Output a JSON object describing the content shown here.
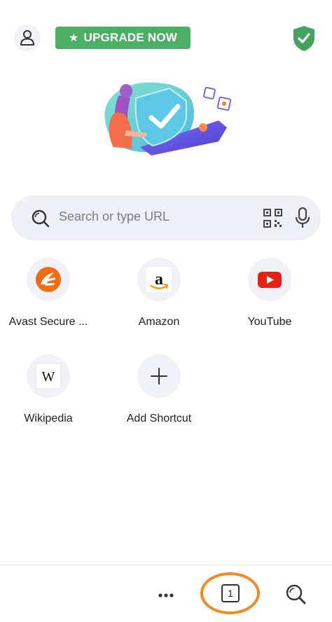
{
  "header": {
    "profile_icon": "user-icon",
    "upgrade_label": "UPGRADE NOW",
    "upgrade_icon": "star-icon",
    "upgrade_color": "#4caf64",
    "shield_icon": "shield-check-icon",
    "shield_color": "#46a35f"
  },
  "search": {
    "placeholder": "Search or type URL",
    "left_icon": "search-icon",
    "qr_icon": "qr-code-icon",
    "voice_icon": "microphone-icon"
  },
  "shortcuts": [
    {
      "label": "Avast Secure ...",
      "icon": "avast-logo-icon",
      "color": "#f46b12"
    },
    {
      "label": "Amazon",
      "icon": "amazon-logo-icon",
      "color": "#ff9900"
    },
    {
      "label": "YouTube",
      "icon": "youtube-logo-icon",
      "color": "#e62117"
    },
    {
      "label": "Wikipedia",
      "icon": "wikipedia-logo-icon",
      "glyph": "W"
    },
    {
      "label": "Add Shortcut",
      "icon": "plus-icon"
    }
  ],
  "bottom_bar": {
    "menu_icon": "more-dots-icon",
    "tab_count": "1",
    "search_icon": "search-icon",
    "highlight_color": "#f08a24"
  }
}
